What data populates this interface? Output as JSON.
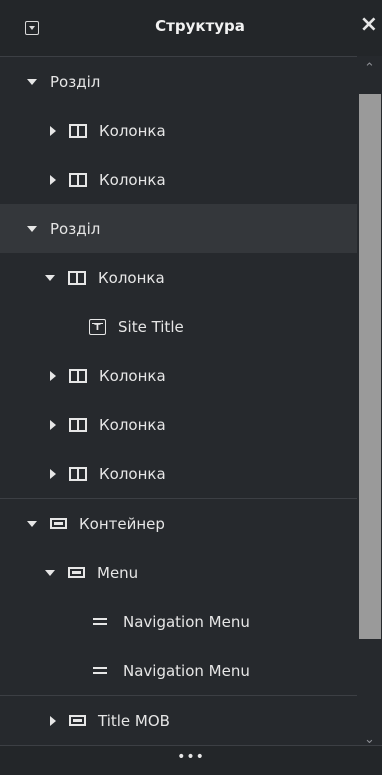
{
  "header": {
    "title": "Структура",
    "close_symbol": "×"
  },
  "tree": [
    {
      "label": "Розділ",
      "type": "section",
      "expanded": true
    },
    {
      "label": "Колонка",
      "type": "column",
      "expanded": false
    },
    {
      "label": "Колонка",
      "type": "column",
      "expanded": false
    },
    {
      "label": "Розділ",
      "type": "section",
      "expanded": true,
      "selected": true
    },
    {
      "label": "Колонка",
      "type": "column",
      "expanded": true
    },
    {
      "label": "Site Title",
      "type": "widget-site-title"
    },
    {
      "label": "Колонка",
      "type": "column",
      "expanded": false
    },
    {
      "label": "Колонка",
      "type": "column",
      "expanded": false
    },
    {
      "label": "Колонка",
      "type": "column",
      "expanded": false
    },
    {
      "label": "Контейнер",
      "type": "container",
      "expanded": true
    },
    {
      "label": "Menu",
      "type": "container",
      "expanded": true
    },
    {
      "label": "Navigation Menu",
      "type": "widget-nav-menu"
    },
    {
      "label": "Navigation Menu",
      "type": "widget-nav-menu"
    },
    {
      "label": "Title MOB",
      "type": "container",
      "expanded": false
    }
  ],
  "footer": {
    "dots": "•••"
  },
  "colors": {
    "panel_bg": "#26292d",
    "header_bg": "#232629",
    "selected_row_bg": "#34373b",
    "scroll_thumb": "#9a9a9a",
    "text": "#e6e6e6"
  }
}
